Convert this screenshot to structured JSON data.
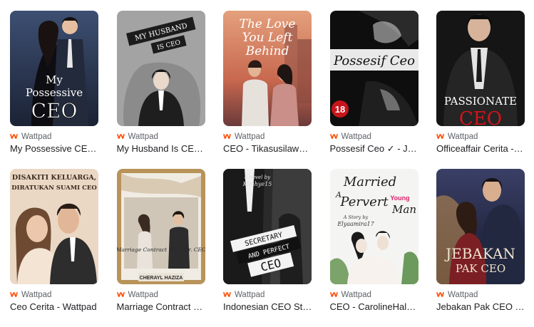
{
  "results": [
    {
      "source": "Wattpad",
      "title": "My Possessive CE…",
      "cover_text": [
        "My",
        "Possessive",
        "CEO"
      ],
      "cover_bg": "#2d3a55"
    },
    {
      "source": "Wattpad",
      "title": "My Husband Is CE…",
      "cover_text": [
        "MY HUSBAND",
        "IS CEO"
      ],
      "cover_bg": "#9a9a9a"
    },
    {
      "source": "Wattpad",
      "title": "CEO - Tikasusilaw…",
      "cover_text": [
        "The Love",
        "You Left",
        "Behind"
      ],
      "cover_bg": "#d27b5c"
    },
    {
      "source": "Wattpad",
      "title": "Possesif Ceo ✓ - J…",
      "cover_text": [
        "Possesif Ceo",
        "18"
      ],
      "cover_bg": "#111111"
    },
    {
      "source": "Wattpad",
      "title": "Officeaffair Cerita -…",
      "cover_text": [
        "PASSIONATE",
        "CEO"
      ],
      "cover_bg": "#161616"
    },
    {
      "source": "Wattpad",
      "title": "Ceo Cerita - Wattpad",
      "cover_text": [
        "DISAKITI KELUARGA,",
        "DIRATUKAN SUAMI CEO"
      ],
      "cover_bg": "#e9d6c2"
    },
    {
      "source": "Wattpad",
      "title": "Marriage Contract …",
      "cover_text": [
        "Marriage Contract With Mr. CEO",
        "CHERAYL HAZIZA"
      ],
      "cover_bg": "#b69157"
    },
    {
      "source": "Wattpad",
      "title": "Indonesian CEO St…",
      "cover_text": [
        "a novel by",
        "Kimhye15",
        "SECRETARY",
        "AND PERFECT",
        "CEO"
      ],
      "cover_bg": "#2b2b2b"
    },
    {
      "source": "Wattpad",
      "title": "CEO - CarolineHal…",
      "cover_text": [
        "Married",
        "A",
        "Pervert",
        "Young",
        "Man",
        "A Story by",
        "Elyaamira17"
      ],
      "cover_bg": "#f2f2f2"
    },
    {
      "source": "Wattpad",
      "title": "Jebakan Pak CEO …",
      "cover_text": [
        "JEBAKAN",
        "PAK CEO"
      ],
      "cover_bg": "#1f2440"
    }
  ],
  "colors": {
    "wattpad_icon": "#ff500a",
    "source_text": "#5f6368",
    "title_text": "#202124"
  },
  "icons": {
    "source_icon": "wattpad-logo-icon"
  }
}
